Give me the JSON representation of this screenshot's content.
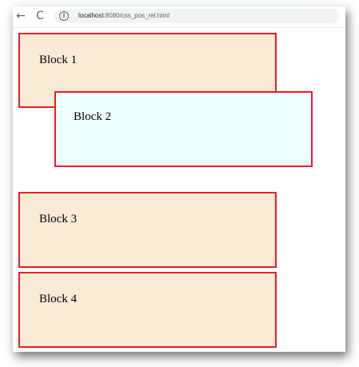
{
  "browser": {
    "url_host": "localhost",
    "url_path": ":8080/css_pos_rel.html",
    "back_glyph": "←",
    "reload_glyph": "C",
    "info_glyph": "i"
  },
  "blocks": [
    {
      "label": "Block 1",
      "background": "#faebd7",
      "border": "#ed1c24"
    },
    {
      "label": "Block 2",
      "background": "#f0ffff",
      "border": "#ed1c24"
    },
    {
      "label": "Block 3",
      "background": "#faebd7",
      "border": "#ed1c24"
    },
    {
      "label": "Block 4",
      "background": "#faebd7",
      "border": "#ed1c24"
    }
  ]
}
